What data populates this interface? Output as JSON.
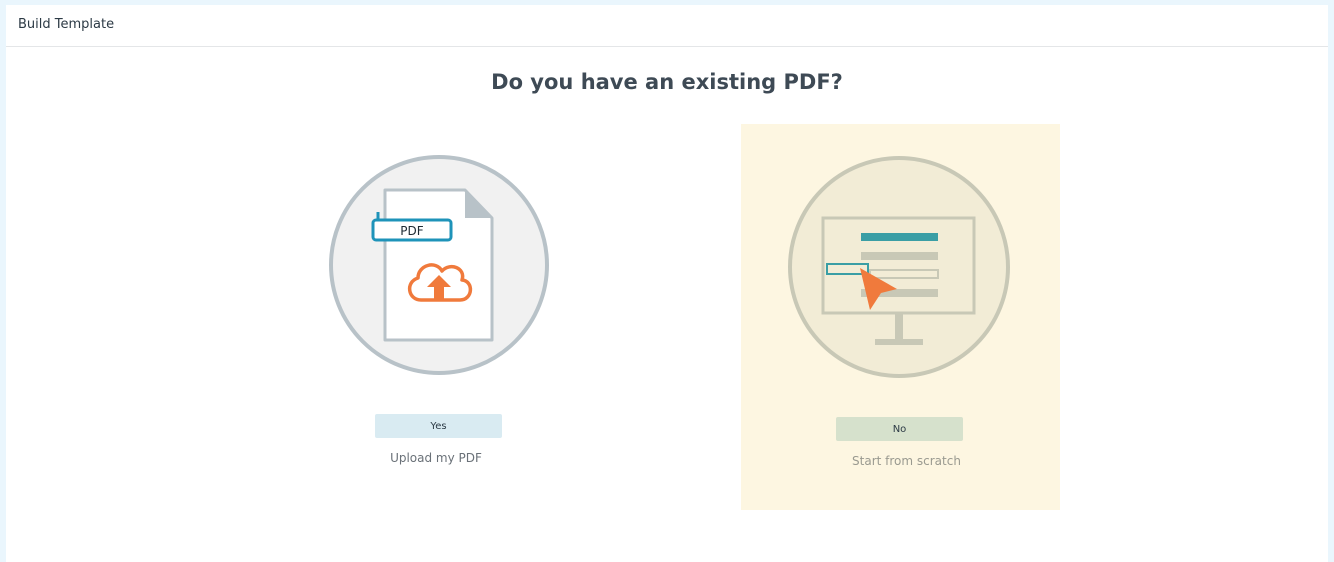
{
  "header": {
    "title": "Build Template"
  },
  "main": {
    "question": "Do you have an existing PDF?",
    "options": [
      {
        "button_label": "Yes",
        "caption": "Upload my PDF",
        "illustration_label": "PDF",
        "selected": false
      },
      {
        "button_label": "No",
        "caption": "Start from scratch",
        "selected": true
      }
    ]
  },
  "colors": {
    "page_background": "#eaf6fd",
    "selected_card": "#fdf6e1",
    "yes_button": "#d9ebf2",
    "no_button": "#d6e1cc",
    "accent_blue": "#1e93b9",
    "accent_orange": "#f07a3c",
    "accent_teal": "#3a9ea5"
  },
  "icons": [
    "pdf-upload-icon",
    "cloud-upload-icon",
    "monitor-form-icon",
    "cursor-arrow-icon"
  ]
}
